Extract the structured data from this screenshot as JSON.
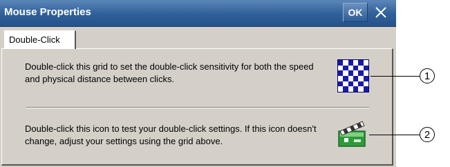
{
  "window": {
    "title": "Mouse Properties",
    "ok_label": "OK",
    "close_icon": "close-icon"
  },
  "tabs": [
    {
      "label": "Double-Click",
      "selected": true
    }
  ],
  "panel": {
    "grid_text": "Double-click this grid to set the double-click sensitivity for both the speed and physical distance between clicks.",
    "grid_icon": "checkerboard-grid-icon",
    "test_text": "Double-click this icon to test your double-click settings. If this icon doesn't change, adjust your settings using the grid above.",
    "test_icon": "clapperboard-icon"
  },
  "callouts": [
    "1",
    "2"
  ],
  "colors": {
    "titlebar": "#2f5f99",
    "dialog_bg": "#d4d0c8",
    "grid_blue": "#1a1aa8"
  }
}
